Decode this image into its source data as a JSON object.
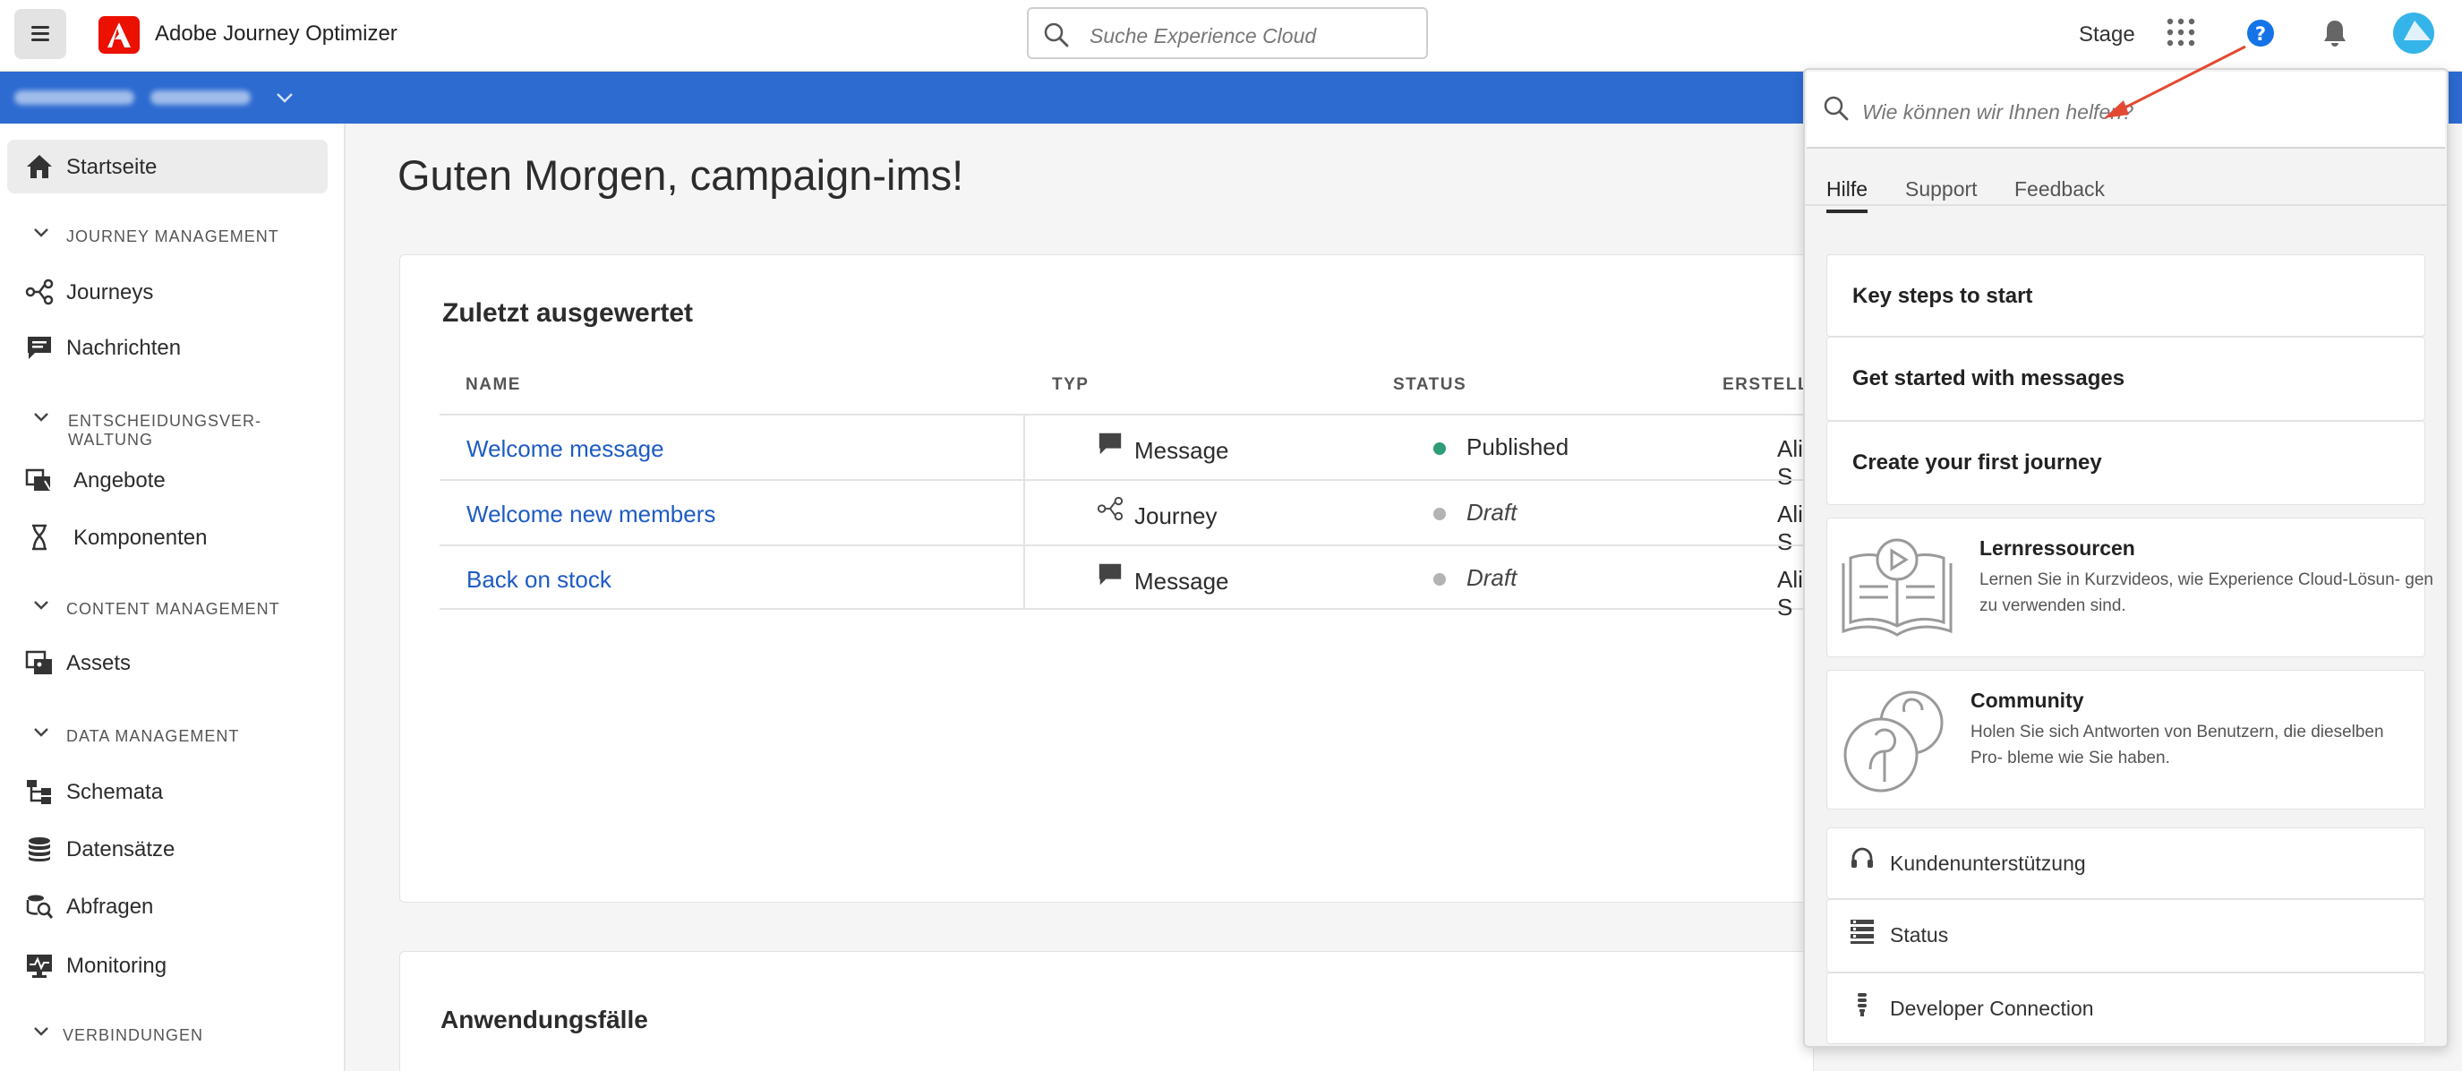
{
  "header": {
    "app_title": "Adobe Journey Optimizer",
    "search_placeholder": "Suche Experience Cloud",
    "environment": "Stage"
  },
  "sidebar": {
    "items": [
      {
        "label": "Startseite",
        "icon": "home-icon",
        "active": true
      },
      {
        "label": "Journeys",
        "icon": "journey-icon"
      },
      {
        "label": "Nachrichten",
        "icon": "message-icon"
      },
      {
        "label": "Angebote",
        "icon": "offers-icon"
      },
      {
        "label": "Komponenten",
        "icon": "components-icon"
      },
      {
        "label": "Assets",
        "icon": "assets-icon"
      },
      {
        "label": "Schemata",
        "icon": "schema-icon"
      },
      {
        "label": "Datensätze",
        "icon": "datasets-icon"
      },
      {
        "label": "Abfragen",
        "icon": "queries-icon"
      },
      {
        "label": "Monitoring",
        "icon": "monitoring-icon"
      }
    ],
    "sections": [
      "JOURNEY MANAGEMENT",
      "ENTSCHEIDUNGSVER- WALTUNG",
      "CONTENT MANAGEMENT",
      "DATA MANAGEMENT",
      "VERBINDUNGEN"
    ]
  },
  "main": {
    "greeting": "Guten Morgen, campaign-ims!",
    "recent": {
      "title": "Zuletzt ausgewertet",
      "columns": [
        "NAME",
        "TYP",
        "STATUS",
        "ERSTELLT"
      ],
      "rows": [
        {
          "name": "Welcome message",
          "type": "Message",
          "status": "Published",
          "status_color": "#2d9d78",
          "created_by": "Alice S"
        },
        {
          "name": "Welcome new members",
          "type": "Journey",
          "status": "Draft",
          "status_color": "#b3b3b3",
          "created_by": "Alice S"
        },
        {
          "name": "Back on stock",
          "type": "Message",
          "status": "Draft",
          "status_color": "#b3b3b3",
          "created_by": "Alice S"
        }
      ]
    },
    "usecases_title": "Anwendungsfälle"
  },
  "help_panel": {
    "search_placeholder": "Wie können wir Ihnen helfen?",
    "tabs": [
      "Hilfe",
      "Support",
      "Feedback"
    ],
    "quick_links": [
      "Key steps to start",
      "Get started with messages",
      "Create your first journey"
    ],
    "resources": [
      {
        "title": "Lernressourcen",
        "desc": "Lernen Sie in Kurzvideos, wie Experience Cloud-Lösun- gen zu verwenden sind."
      },
      {
        "title": "Community",
        "desc": "Holen Sie sich Antworten von Benutzern, die dieselben Pro- bleme wie Sie haben."
      }
    ],
    "links": [
      {
        "label": "Kundenunterstützung",
        "icon": "headset-icon"
      },
      {
        "label": "Status",
        "icon": "status-icon"
      },
      {
        "label": "Developer Connection",
        "icon": "developer-icon"
      }
    ]
  },
  "colors": {
    "brand_blue": "#2d6bd1",
    "link_blue": "#1d5bc4",
    "adobe_red": "#eb1000",
    "help_blue": "#1473e6",
    "arrow_red": "#e34a33"
  }
}
